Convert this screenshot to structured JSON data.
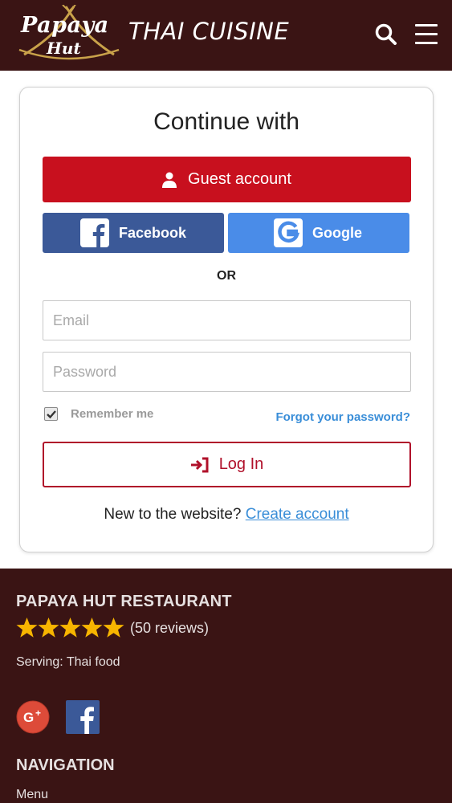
{
  "header": {
    "logo_top": "Papaya",
    "logo_bottom": "Hut",
    "tagline": "THAI CUISINE",
    "background": "#3a1414"
  },
  "login": {
    "title": "Continue with",
    "guest_label": "Guest account",
    "facebook_label": "Facebook",
    "google_label": "Google",
    "or_label": "OR",
    "email_placeholder": "Email",
    "password_placeholder": "Password",
    "remember_label": "Remember me",
    "remember_checked": true,
    "forgot_label": "Forgot your password?",
    "login_label": "Log In",
    "new_prompt": "New to the website?",
    "create_label": "Create account",
    "colors": {
      "guest": "#c8101e",
      "facebook": "#3b5998",
      "google": "#4a8ce8",
      "link": "#3a8ed8",
      "login_border": "#b0102a"
    }
  },
  "footer": {
    "restaurant_title": "PAPAYA HUT RESTAURANT",
    "rating_stars": 5,
    "reviews": "(50 reviews)",
    "serving": "Serving: Thai food",
    "social": [
      "google-plus-icon",
      "facebook-icon"
    ],
    "nav_title": "NAVIGATION",
    "nav_items": [
      "Menu"
    ]
  }
}
